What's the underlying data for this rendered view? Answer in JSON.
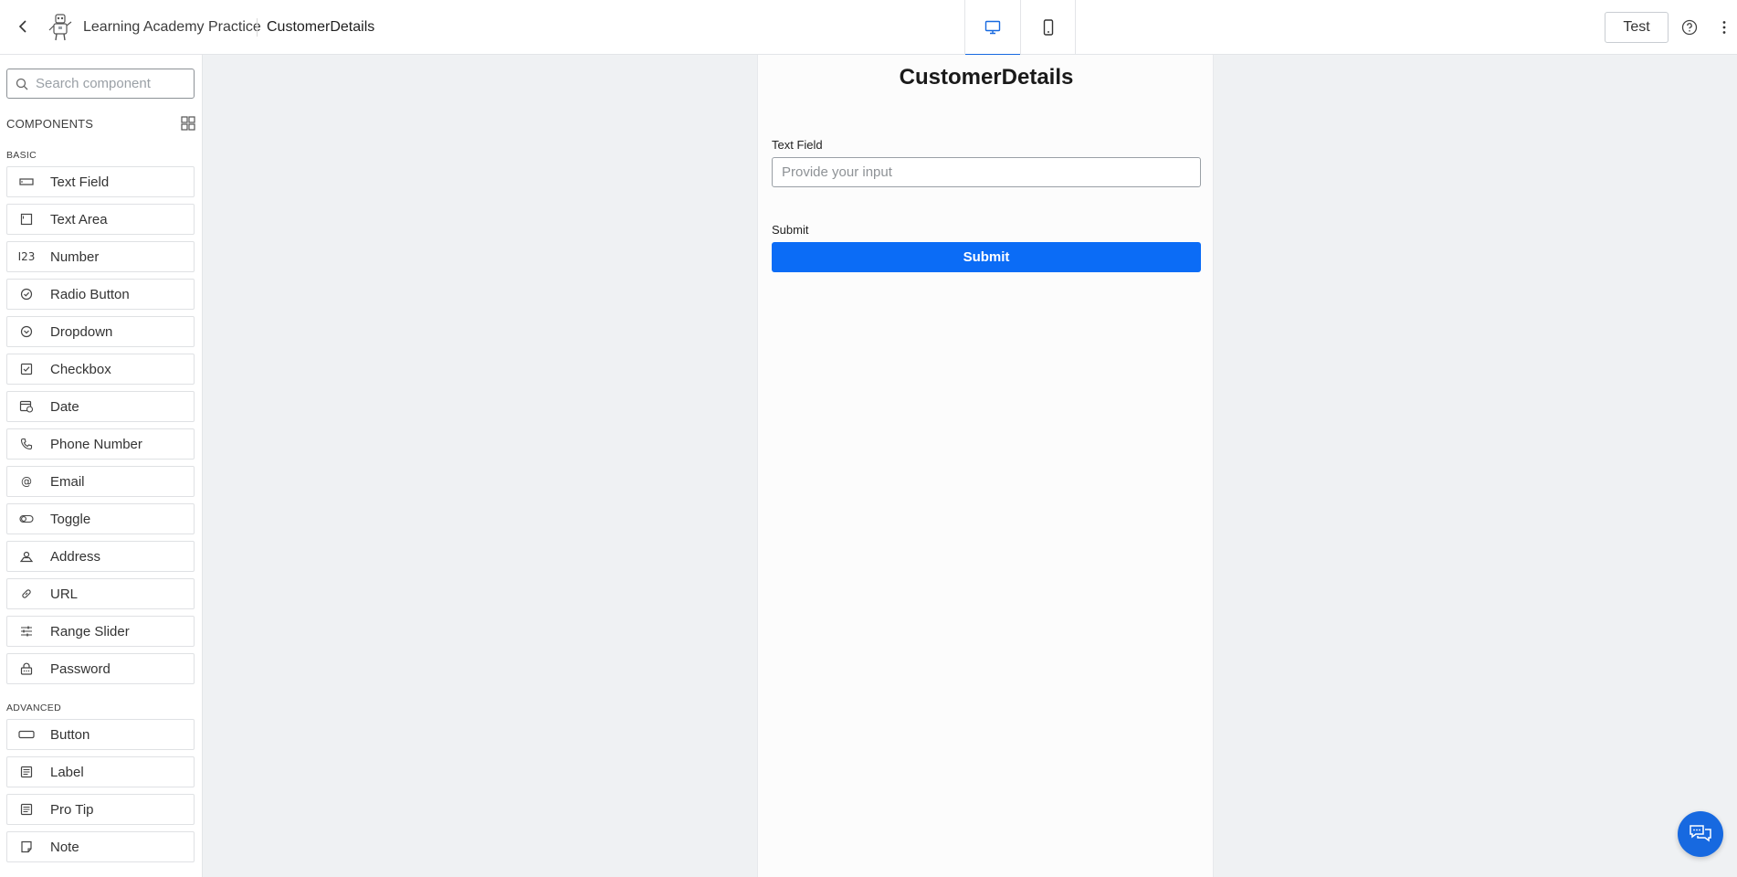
{
  "header": {
    "app_name": "Learning Academy Practice",
    "page_name": "CustomerDetails",
    "test_label": "Test",
    "view_modes": [
      "desktop-icon",
      "mobile-icon"
    ],
    "active_view": "desktop"
  },
  "sidebar": {
    "search_placeholder": "Search component",
    "components_header": "COMPONENTS",
    "basic_label": "BASIC",
    "advanced_label": "ADVANCED",
    "basic_items": [
      {
        "label": "Text Field",
        "icon": "text-field-icon"
      },
      {
        "label": "Text Area",
        "icon": "text-area-icon"
      },
      {
        "label": "Number",
        "icon": "number-icon",
        "glyph": "I23"
      },
      {
        "label": "Radio Button",
        "icon": "radio-button-icon"
      },
      {
        "label": "Dropdown",
        "icon": "dropdown-icon"
      },
      {
        "label": "Checkbox",
        "icon": "checkbox-icon"
      },
      {
        "label": "Date",
        "icon": "date-icon"
      },
      {
        "label": "Phone Number",
        "icon": "phone-icon"
      },
      {
        "label": "Email",
        "icon": "email-icon",
        "glyph": "@"
      },
      {
        "label": "Toggle",
        "icon": "toggle-icon"
      },
      {
        "label": "Address",
        "icon": "address-icon"
      },
      {
        "label": "URL",
        "icon": "link-icon"
      },
      {
        "label": "Range Slider",
        "icon": "range-slider-icon"
      },
      {
        "label": "Password",
        "icon": "password-icon"
      }
    ],
    "advanced_items": [
      {
        "label": "Button",
        "icon": "button-icon"
      },
      {
        "label": "Label",
        "icon": "label-icon"
      },
      {
        "label": "Pro Tip",
        "icon": "pro-tip-icon"
      },
      {
        "label": "Note",
        "icon": "note-icon"
      }
    ]
  },
  "form": {
    "title": "CustomerDetails",
    "text_field_label": "Text Field",
    "text_field_placeholder": "Provide your input",
    "submit_label": "Submit",
    "submit_button": "Submit"
  },
  "colors": {
    "accent": "#0b6cf6",
    "background": "#eff1f3",
    "panel": "#ffffff"
  }
}
